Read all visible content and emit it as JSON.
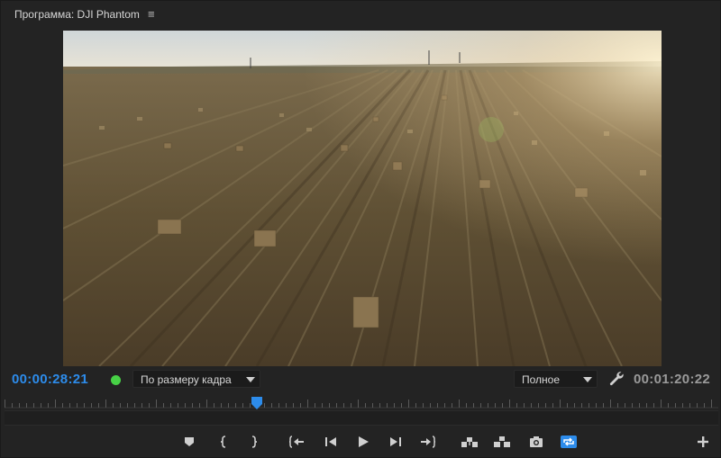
{
  "header": {
    "title": "Программа: DJI Phantom",
    "menu_icon": "≡"
  },
  "viewer": {
    "content": "aerial drone view of harvested field with hay bales at sunset"
  },
  "timecode": {
    "current": "00:00:28:21",
    "duration": "00:01:20:22",
    "current_color": "#2d8ceb",
    "status_color": "#47d146"
  },
  "zoom_select": {
    "selected": "По размеру кадра"
  },
  "quality_select": {
    "selected": "Полное"
  },
  "playhead": {
    "position_fraction": 0.353
  },
  "transport": {
    "buttons": [
      "marker-icon",
      "mark-in-icon",
      "mark-out-icon",
      "go-to-in-icon",
      "step-back-icon",
      "play-icon",
      "step-forward-icon",
      "go-to-out-icon",
      "lift-icon",
      "extract-icon",
      "camera-icon",
      "loop-icon",
      "add-icon"
    ],
    "active_color": "#2d8ceb"
  }
}
